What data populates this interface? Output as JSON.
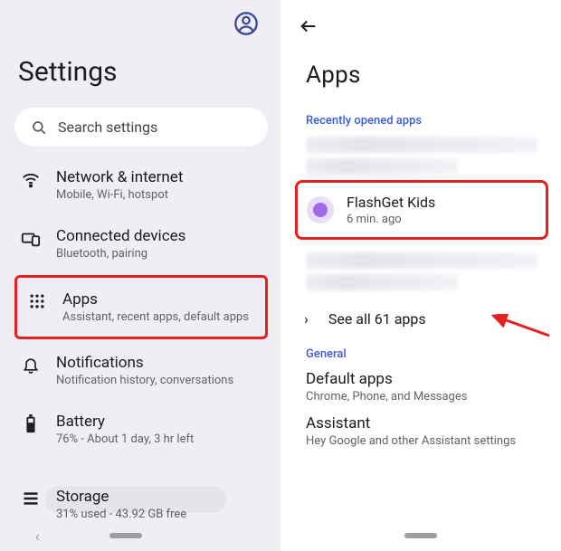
{
  "left": {
    "title": "Settings",
    "search_placeholder": "Search settings",
    "items": [
      {
        "title": "Network & internet",
        "sub": "Mobile, Wi-Fi, hotspot"
      },
      {
        "title": "Connected devices",
        "sub": "Bluetooth, pairing"
      },
      {
        "title": "Apps",
        "sub": "Assistant, recent apps, default apps"
      },
      {
        "title": "Notifications",
        "sub": "Notification history, conversations"
      },
      {
        "title": "Battery",
        "sub": "76% - About 1 day, 3 hr left"
      },
      {
        "title": "Storage",
        "sub": "31% used - 43.92 GB free"
      }
    ]
  },
  "right": {
    "title": "Apps",
    "recently_label": "Recently opened apps",
    "highlighted_app": {
      "name": "FlashGet Kids",
      "sub": "6 min. ago"
    },
    "see_all": "See all 61 apps",
    "general_label": "General",
    "default_apps": {
      "title": "Default apps",
      "sub": "Chrome, Phone, and Messages"
    },
    "assistant": {
      "title": "Assistant",
      "sub": "Hey Google and other Assistant settings"
    }
  }
}
